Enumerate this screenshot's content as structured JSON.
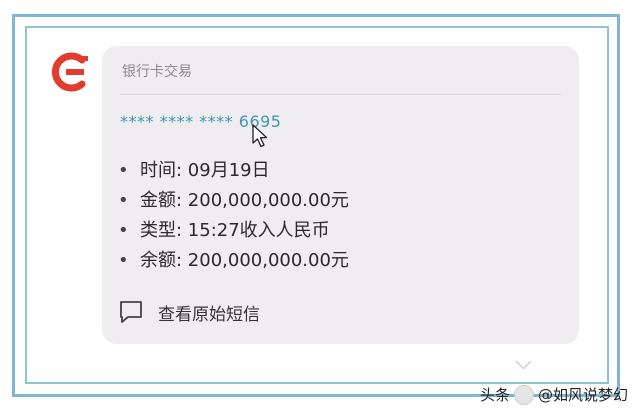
{
  "notification": {
    "title": "银行卡交易",
    "card_number": "**** **** **** 6695",
    "details": [
      "时间: 09月19日",
      "金额: 200,000,000.00元",
      "类型: 15:27收入人民币",
      "余额: 200,000,000.00元"
    ],
    "view_original_label": "查看原始短信"
  },
  "watermark": {
    "prefix": "头条",
    "author": "@如风说梦幻"
  },
  "colors": {
    "frame": "#7fb6d2",
    "logo": "#e03c2f",
    "card_bg": "#f0edf0",
    "link": "#3e97b5"
  },
  "icons": {
    "logo": "bank-logo-icon",
    "cursor": "mouse-cursor-icon",
    "sms": "message-bubble-icon"
  }
}
